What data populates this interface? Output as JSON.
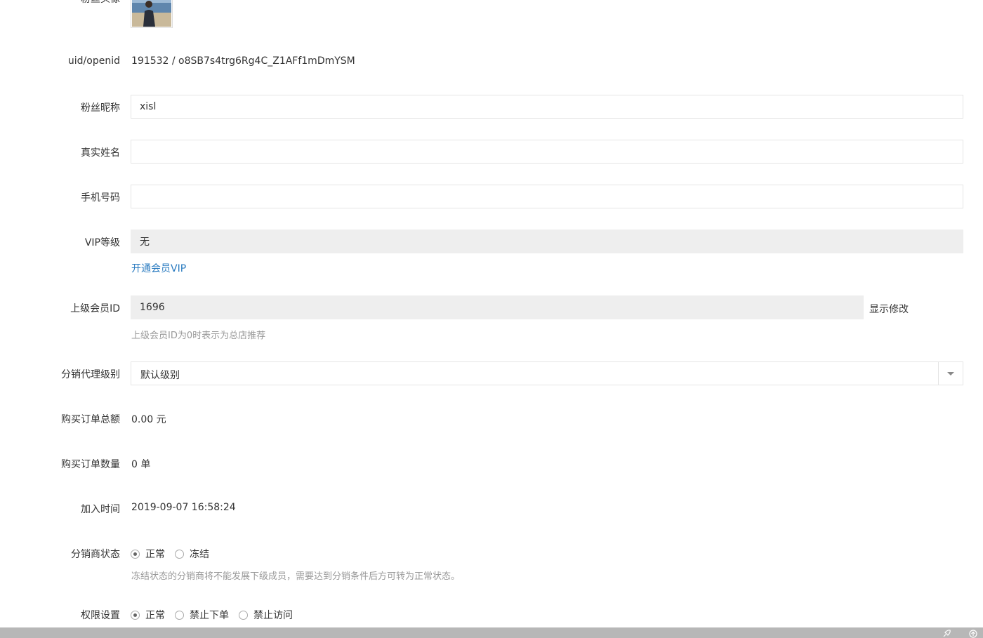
{
  "avatar": {
    "label": "粉丝头像"
  },
  "uid": {
    "label": "uid/openid",
    "value": "191532 / o8SB7s4trg6Rg4C_Z1AFf1mDmYSM"
  },
  "nickname": {
    "label": "粉丝昵称",
    "value": "xisl"
  },
  "realname": {
    "label": "真实姓名",
    "value": ""
  },
  "mobile": {
    "label": "手机号码",
    "value": ""
  },
  "vip": {
    "label": "VIP等级",
    "value": "无",
    "link": "开通会员VIP"
  },
  "parent": {
    "label": "上级会员ID",
    "value": "1696",
    "action": "显示修改",
    "help": "上级会员ID为0时表示为总店推荐"
  },
  "agent_level": {
    "label": "分销代理级别",
    "selected": "默认级别"
  },
  "order_total": {
    "label": "购买订单总额",
    "value": "0.00 元"
  },
  "order_count": {
    "label": "购买订单数量",
    "value": "0 单"
  },
  "join_time": {
    "label": "加入时间",
    "value": "2019-09-07 16:58:24"
  },
  "agent_status": {
    "label": "分销商状态",
    "options": [
      "正常",
      "冻结"
    ],
    "help": "冻结状态的分销商将不能发展下级成员，需要达到分销条件后方可转为正常状态。"
  },
  "permission": {
    "label": "权限设置",
    "options": [
      "正常",
      "禁止下单",
      "禁止访问"
    ]
  },
  "colors": {
    "link": "#2a7bc0",
    "readonly_bg": "#eeeeee",
    "border": "#e5e5e5",
    "help": "#999999",
    "bar": "#b7b7b7"
  }
}
